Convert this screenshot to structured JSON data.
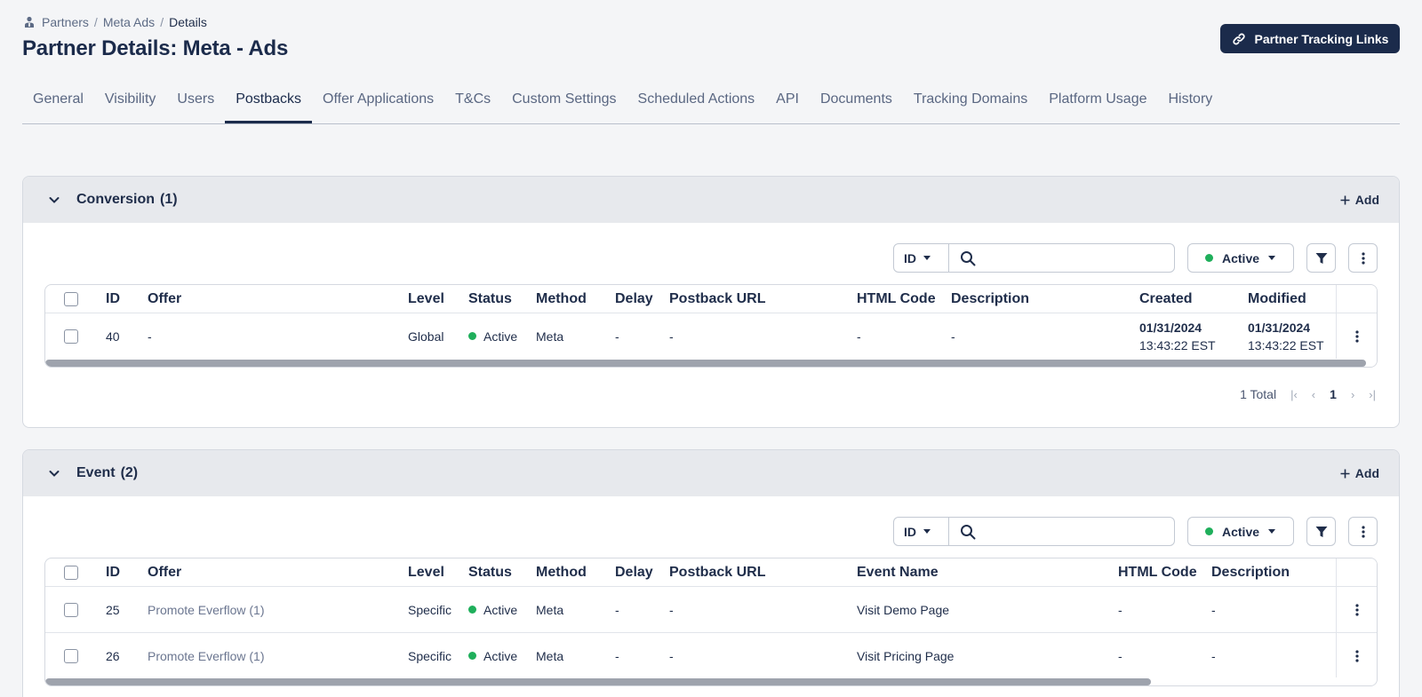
{
  "breadcrumb": {
    "items": [
      "Partners",
      "Meta Ads"
    ],
    "current": "Details"
  },
  "page_title": "Partner Details: Meta - Ads",
  "tracking_button_label": "Partner Tracking Links",
  "tabs": [
    "General",
    "Visibility",
    "Users",
    "Postbacks",
    "Offer Applications",
    "T&Cs",
    "Custom Settings",
    "Scheduled Actions",
    "API",
    "Documents",
    "Tracking Domains",
    "Platform Usage",
    "History"
  ],
  "active_tab": "Postbacks",
  "conversion": {
    "title": "Conversion",
    "count": "(1)",
    "add_label": "Add",
    "search_field": "ID",
    "search_value": "",
    "status_filter": "Active",
    "columns": [
      "ID",
      "Offer",
      "Level",
      "Status",
      "Method",
      "Delay",
      "Postback URL",
      "HTML Code",
      "Description",
      "Created",
      "Modified"
    ],
    "rows": [
      {
        "id": "40",
        "offer": "-",
        "level": "Global",
        "status": "Active",
        "method": "Meta",
        "delay": "-",
        "postback_url": "-",
        "html_code": "-",
        "description": "-",
        "created_date": "01/31/2024",
        "created_time": "13:43:22 EST",
        "modified_date": "01/31/2024",
        "modified_time": "13:43:22 EST"
      }
    ],
    "total": "1 Total",
    "page": "1"
  },
  "event": {
    "title": "Event",
    "count": "(2)",
    "add_label": "Add",
    "search_field": "ID",
    "search_value": "",
    "status_filter": "Active",
    "columns": [
      "ID",
      "Offer",
      "Level",
      "Status",
      "Method",
      "Delay",
      "Postback URL",
      "Event Name",
      "HTML Code",
      "Description"
    ],
    "rows": [
      {
        "id": "25",
        "offer": "Promote Everflow (1)",
        "level": "Specific",
        "status": "Active",
        "method": "Meta",
        "delay": "-",
        "postback_url": "-",
        "event_name": "Visit Demo Page",
        "html_code": "-",
        "description": "-"
      },
      {
        "id": "26",
        "offer": "Promote Everflow (1)",
        "level": "Specific",
        "status": "Active",
        "method": "Meta",
        "delay": "-",
        "postback_url": "-",
        "event_name": "Visit Pricing Page",
        "html_code": "-",
        "description": "-"
      }
    ]
  },
  "colors": {
    "primary": "#1b2b4b",
    "active_status": "#1faf5b",
    "header_bg": "#e7e9ed"
  }
}
